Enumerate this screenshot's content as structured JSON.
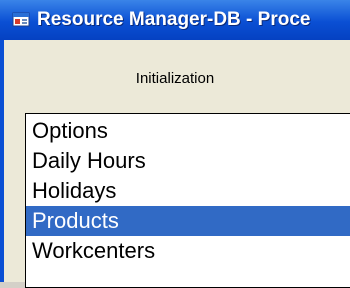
{
  "window": {
    "title": "Resource Manager-DB - Proce",
    "icon": "app-window-icon"
  },
  "section": {
    "label": "Initialization"
  },
  "list": {
    "items": [
      {
        "label": "Options",
        "selected": false
      },
      {
        "label": "Daily Hours",
        "selected": false
      },
      {
        "label": "Holidays",
        "selected": false
      },
      {
        "label": "Products",
        "selected": true
      },
      {
        "label": "Workcenters",
        "selected": false
      }
    ],
    "selection_color": "#316ac5"
  },
  "colors": {
    "titlebar": "#0a4fd4",
    "client_bg": "#ece9d8"
  }
}
